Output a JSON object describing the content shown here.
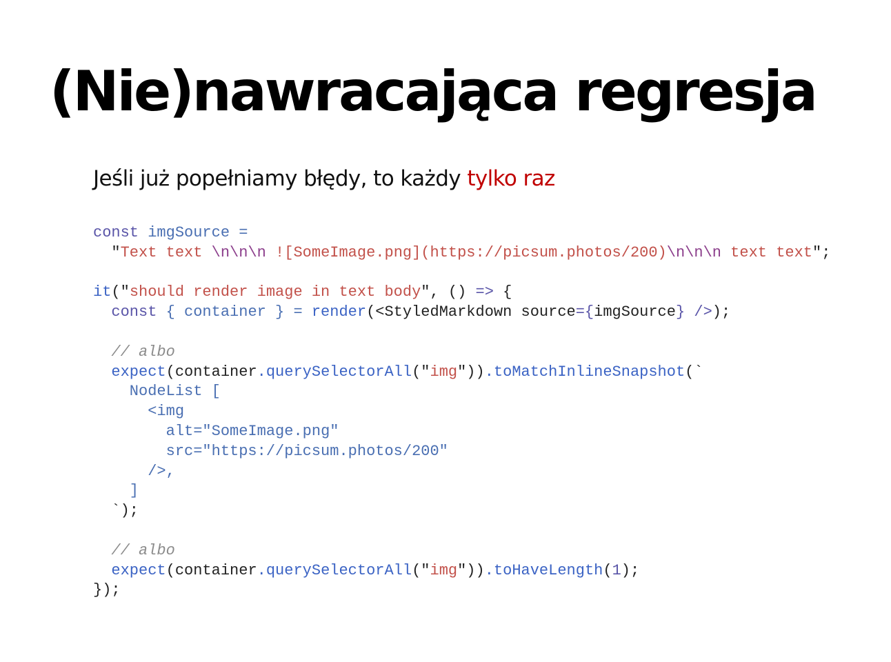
{
  "slide": {
    "title": "(Nie)nawracająca regresja",
    "subtitle": {
      "text": "Jeśli już popełniamy błędy, to każdy ",
      "highlight": "tylko raz",
      "highlight_color": "#c00000"
    }
  },
  "code": {
    "language": "javascript",
    "colors": {
      "keyword": "#5a55a8",
      "identifier": "#4a6fb2",
      "function": "#3b63c4",
      "string": "#c2514a",
      "escape": "#8c3f8c",
      "comment": "#8b8b8b"
    },
    "lines": [
      [
        {
          "t": "kw",
          "v": "const "
        },
        {
          "t": "id",
          "v": "imgSource ="
        }
      ],
      [
        {
          "t": "pl",
          "v": "  \""
        },
        {
          "t": "str",
          "v": "Text text "
        },
        {
          "t": "esc",
          "v": "\\n\\n\\n"
        },
        {
          "t": "str",
          "v": " ![SomeImage.png](https://picsum.photos/200)"
        },
        {
          "t": "esc",
          "v": "\\n\\n\\n"
        },
        {
          "t": "str",
          "v": " text text"
        },
        {
          "t": "pl",
          "v": "\";"
        }
      ],
      [],
      [
        {
          "t": "fn",
          "v": "it"
        },
        {
          "t": "pl",
          "v": "(\""
        },
        {
          "t": "str",
          "v": "should render image in text body"
        },
        {
          "t": "pl",
          "v": "\", () "
        },
        {
          "t": "kw",
          "v": "=>"
        },
        {
          "t": "pl",
          "v": " {"
        }
      ],
      [
        {
          "t": "pl",
          "v": "  "
        },
        {
          "t": "kw",
          "v": "const "
        },
        {
          "t": "id",
          "v": "{ container } = "
        },
        {
          "t": "fn",
          "v": "render"
        },
        {
          "t": "pl",
          "v": "(<StyledMarkdown source"
        },
        {
          "t": "kw",
          "v": "={"
        },
        {
          "t": "pl",
          "v": "imgSource"
        },
        {
          "t": "kw",
          "v": "} />"
        },
        {
          "t": "pl",
          "v": ");"
        }
      ],
      [],
      [
        {
          "t": "com",
          "v": "  // albo"
        }
      ],
      [
        {
          "t": "pl",
          "v": "  "
        },
        {
          "t": "fn",
          "v": "expect"
        },
        {
          "t": "pl",
          "v": "(container"
        },
        {
          "t": "fn",
          "v": ".querySelectorAll"
        },
        {
          "t": "pl",
          "v": "(\""
        },
        {
          "t": "str",
          "v": "img"
        },
        {
          "t": "pl",
          "v": "\"))"
        },
        {
          "t": "fn",
          "v": ".toMatchInlineSnapshot"
        },
        {
          "t": "pl",
          "v": "(`"
        }
      ],
      [
        {
          "t": "id",
          "v": "    NodeList ["
        }
      ],
      [
        {
          "t": "id",
          "v": "      <img"
        }
      ],
      [
        {
          "t": "id",
          "v": "        alt=\""
        },
        {
          "t": "id",
          "v": "SomeImage.png\""
        }
      ],
      [
        {
          "t": "id",
          "v": "        src=\"https://picsum.photos/200\""
        }
      ],
      [
        {
          "t": "id",
          "v": "      />,"
        }
      ],
      [
        {
          "t": "id",
          "v": "    ]"
        }
      ],
      [
        {
          "t": "pl",
          "v": "  `);"
        }
      ],
      [],
      [
        {
          "t": "com",
          "v": "  // albo"
        }
      ],
      [
        {
          "t": "pl",
          "v": "  "
        },
        {
          "t": "fn",
          "v": "expect"
        },
        {
          "t": "pl",
          "v": "(container"
        },
        {
          "t": "fn",
          "v": ".querySelectorAll"
        },
        {
          "t": "pl",
          "v": "(\""
        },
        {
          "t": "str",
          "v": "img"
        },
        {
          "t": "pl",
          "v": "\"))"
        },
        {
          "t": "fn",
          "v": ".toHaveLength"
        },
        {
          "t": "pl",
          "v": "("
        },
        {
          "t": "kw",
          "v": "1"
        },
        {
          "t": "pl",
          "v": ");"
        }
      ],
      [
        {
          "t": "pl",
          "v": "});"
        }
      ]
    ]
  }
}
